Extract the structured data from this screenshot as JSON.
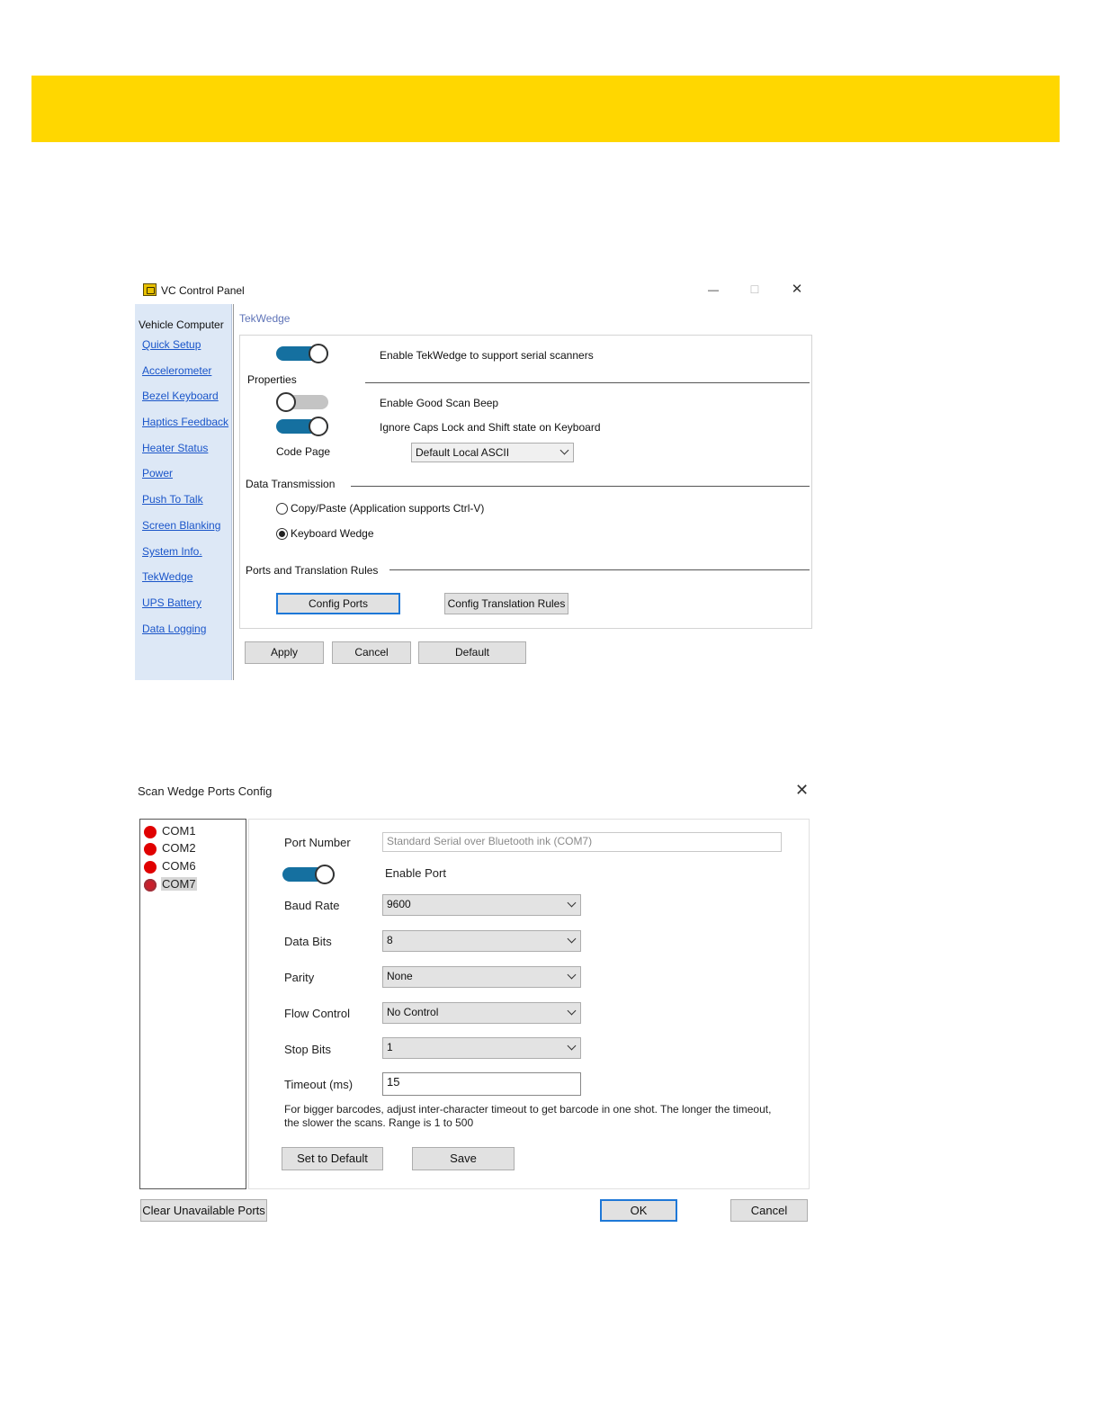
{
  "panel": {
    "title": "VC Control Panel",
    "window_controls": {
      "minimize": "—",
      "maximize": "☐",
      "close": "✕"
    },
    "sidebar": {
      "title": "Vehicle Computer",
      "items": [
        {
          "label": "Quick Setup"
        },
        {
          "label": "Accelerometer"
        },
        {
          "label": "Bezel Keyboard"
        },
        {
          "label": "Haptics Feedback"
        },
        {
          "label": "Heater Status"
        },
        {
          "label": "Power"
        },
        {
          "label": "Push To Talk"
        },
        {
          "label": "Screen Blanking"
        },
        {
          "label": "System Info."
        },
        {
          "label": "TekWedge"
        },
        {
          "label": "UPS Battery"
        },
        {
          "label": "Data Logging"
        }
      ]
    },
    "breadcrumb": "TekWedge",
    "enable_label": "Enable TekWedge to support serial scanners",
    "enable_on": true,
    "properties_label": "Properties",
    "good_scan_beep_label": "Enable Good Scan Beep",
    "good_scan_beep_on": false,
    "ignore_caps_label": "Ignore Caps Lock and Shift state on Keyboard",
    "ignore_caps_on": true,
    "code_page_label": "Code Page",
    "code_page_value": "Default Local ASCII",
    "data_transmission_label": "Data Transmission",
    "radio_copy_paste": "Copy/Paste (Application supports Ctrl-V)",
    "radio_keyboard_wedge": "Keyboard Wedge",
    "selected_mode": "Keyboard Wedge",
    "ports_rules_label": "Ports and Translation Rules",
    "config_ports_button": "Config Ports",
    "config_rules_button": "Config Translation Rules",
    "apply_button": "Apply",
    "cancel_button": "Cancel",
    "default_button": "Default"
  },
  "ports_dialog": {
    "title": "Scan Wedge Ports Config",
    "close": "✕",
    "ports": [
      {
        "label": "COM1"
      },
      {
        "label": "COM2"
      },
      {
        "label": "COM6"
      },
      {
        "label": "COM7"
      }
    ],
    "selected_port": "COM7",
    "port_number_label": "Port Number",
    "port_number_value": "Standard Serial over Bluetooth ink (COM7)",
    "enable_port_label": "Enable Port",
    "enable_port_on": true,
    "baud_rate_label": "Baud Rate",
    "baud_rate_value": "9600",
    "data_bits_label": "Data Bits",
    "data_bits_value": "8",
    "parity_label": "Parity",
    "parity_value": "None",
    "flow_control_label": "Flow Control",
    "flow_control_value": "No Control",
    "stop_bits_label": "Stop Bits",
    "stop_bits_value": "1",
    "timeout_label": "Timeout (ms)",
    "timeout_value": "15",
    "help_text_line1": "For bigger barcodes, adjust inter-character timeout to get barcode in one shot. The longer the timeout,",
    "help_text_line2": "the slower the scans. Range is 1 to 500",
    "set_default_button": "Set to Default",
    "save_button": "Save",
    "clear_ports_button": "Clear Unavailable Ports",
    "ok_button": "OK",
    "cancel_button": "Cancel"
  },
  "colors": {
    "banner": "#ffd700",
    "toggle_on": "#1570a0",
    "sidebar_bg": "#dde8f6",
    "link": "#1a55c9",
    "port_dot": "#e00000"
  }
}
